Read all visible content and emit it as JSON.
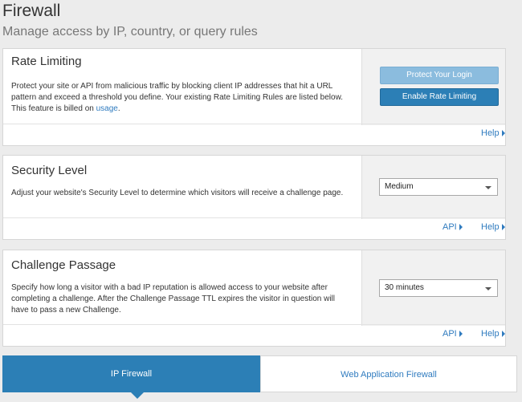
{
  "header": {
    "title": "Firewall",
    "subtitle": "Manage access by IP, country, or query rules"
  },
  "rate_limiting": {
    "title": "Rate Limiting",
    "description": "Protect your site or API from malicious traffic by blocking client IP addresses that hit a URL pattern and exceed a threshold you define. Your existing Rate Limiting Rules are listed below. This feature is billed on ",
    "usage_link": "usage",
    "period": ".",
    "protect_button": "Protect Your Login",
    "enable_button": "Enable Rate Limiting",
    "help": "Help"
  },
  "security_level": {
    "title": "Security Level",
    "description": "Adjust your website's Security Level to determine which visitors will receive a challenge page.",
    "selected": "Medium",
    "api": "API",
    "help": "Help"
  },
  "challenge_passage": {
    "title": "Challenge Passage",
    "description": "Specify how long a visitor with a bad IP reputation is allowed access to your website after completing a challenge. After the Challenge Passage TTL expires the visitor in question will have to pass a new Challenge.",
    "selected": "30 minutes",
    "api": "API",
    "help": "Help"
  },
  "tabs": [
    {
      "label": "IP Firewall",
      "active": true
    },
    {
      "label": "Web Application Firewall",
      "active": false
    }
  ],
  "colors": {
    "accent": "#2c7fb6",
    "link": "#2f7bbf",
    "button_light": "#8bbcde"
  }
}
